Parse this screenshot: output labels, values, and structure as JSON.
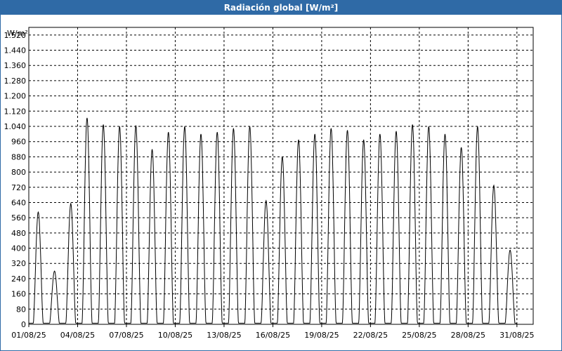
{
  "window": {
    "title": "Radiación global [W/m²]"
  },
  "chart_data": {
    "type": "line",
    "title": "Radiación global [W/m²]",
    "ylabel": "W/m²",
    "xlabel": "",
    "ylim": [
      0,
      1560
    ],
    "xlim": [
      1,
      32
    ],
    "y_ticks": [
      "0",
      "80",
      "160",
      "240",
      "320",
      "400",
      "480",
      "560",
      "640",
      "720",
      "800",
      "880",
      "960",
      "1.040",
      "1.120",
      "1.200",
      "1.280",
      "1.360",
      "1.440",
      "1.520"
    ],
    "y_tick_values": [
      0,
      80,
      160,
      240,
      320,
      400,
      480,
      560,
      640,
      720,
      800,
      880,
      960,
      1040,
      1120,
      1200,
      1280,
      1360,
      1440,
      1520
    ],
    "x_ticks": [
      "01/08/25",
      "04/08/25",
      "07/08/25",
      "10/08/25",
      "13/08/25",
      "16/08/25",
      "19/08/25",
      "22/08/25",
      "25/08/25",
      "28/08/25",
      "31/08/25"
    ],
    "x_tick_days": [
      1,
      4,
      7,
      10,
      13,
      16,
      19,
      22,
      25,
      28,
      31
    ],
    "grid": true,
    "line_color": "#000000",
    "series": [
      {
        "daily_peak_day": [
          1,
          2,
          3,
          4,
          5,
          6,
          7,
          8,
          9,
          10,
          11,
          12,
          13,
          14,
          15,
          16,
          17,
          18,
          19,
          20,
          21,
          22,
          23,
          24,
          25,
          26,
          27,
          28,
          29,
          30,
          31
        ],
        "daily_peak_value": [
          590,
          280,
          635,
          1085,
          1050,
          1040,
          1045,
          920,
          1010,
          1040,
          1000,
          1010,
          1030,
          1040,
          650,
          880,
          970,
          1000,
          1030,
          1020,
          970,
          1000,
          1015,
          1050,
          1040,
          1000,
          930,
          1040,
          730,
          390,
          0
        ]
      }
    ]
  }
}
